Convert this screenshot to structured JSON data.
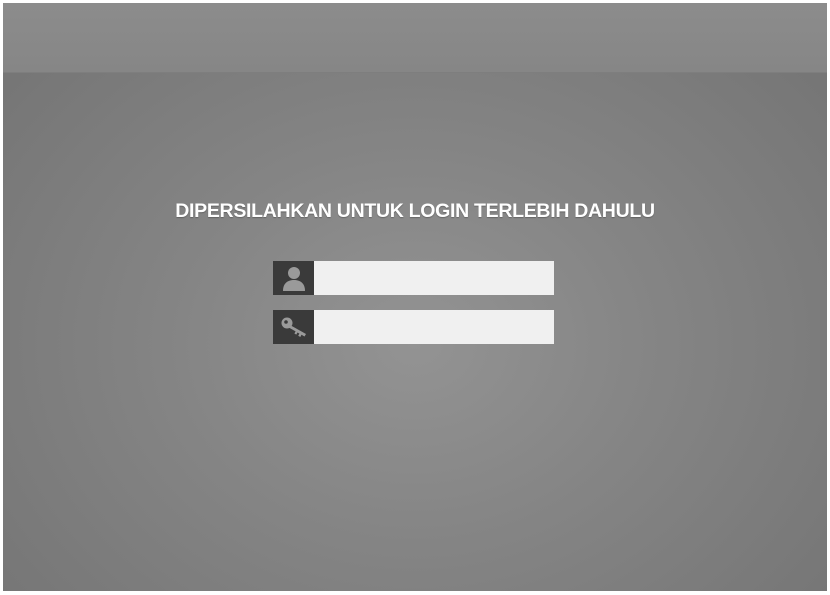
{
  "login": {
    "title": "DIPERSILAHKAN UNTUK LOGIN TERLEBIH DAHULU",
    "username": {
      "icon": "user-icon",
      "value": "",
      "placeholder": ""
    },
    "password": {
      "icon": "key-icon",
      "value": "",
      "placeholder": ""
    }
  },
  "colors": {
    "background": "#858585",
    "icon_box": "#3a3a3a",
    "input_bg": "#f0f0f0",
    "title": "#ffffff"
  }
}
